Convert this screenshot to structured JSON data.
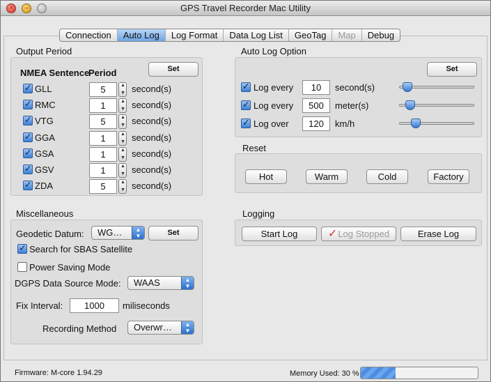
{
  "window": {
    "title": "GPS Travel Recorder Mac Utility"
  },
  "tabs": [
    {
      "label": "Connection",
      "state": "normal"
    },
    {
      "label": "Auto Log",
      "state": "active"
    },
    {
      "label": "Log Format",
      "state": "normal"
    },
    {
      "label": "Data Log List",
      "state": "normal"
    },
    {
      "label": "GeoTag",
      "state": "normal"
    },
    {
      "label": "Map",
      "state": "disabled"
    },
    {
      "label": "Debug",
      "state": "normal"
    }
  ],
  "output_period": {
    "title": "Output Period",
    "set_label": "Set",
    "col_sentence": "NMEA Sentence",
    "col_period": "Period",
    "unit": "second(s)",
    "rows": [
      {
        "name": "GLL",
        "checked": true,
        "value": "5"
      },
      {
        "name": "RMC",
        "checked": true,
        "value": "1"
      },
      {
        "name": "VTG",
        "checked": true,
        "value": "5"
      },
      {
        "name": "GGA",
        "checked": true,
        "value": "1"
      },
      {
        "name": "GSA",
        "checked": true,
        "value": "1"
      },
      {
        "name": "GSV",
        "checked": true,
        "value": "1"
      },
      {
        "name": "ZDA",
        "checked": true,
        "value": "5"
      }
    ]
  },
  "auto_log": {
    "title": "Auto Log Option",
    "set_label": "Set",
    "rows": [
      {
        "label": "Log every",
        "value": "10",
        "unit": "second(s)",
        "checked": true,
        "slider": 0.05
      },
      {
        "label": "Log every",
        "value": "500",
        "unit": "meter(s)",
        "checked": true,
        "slider": 0.1
      },
      {
        "label": "Log over",
        "value": "120",
        "unit": "km/h",
        "checked": true,
        "slider": 0.18
      }
    ]
  },
  "reset": {
    "title": "Reset",
    "hot": "Hot",
    "warm": "Warm",
    "cold": "Cold",
    "factory": "Factory"
  },
  "misc": {
    "title": "Miscellaneous",
    "datum_label": "Geodetic Datum:",
    "datum_value": "WG…",
    "set_label": "Set",
    "sbas_label": "Search for SBAS Satellite",
    "sbas_checked": true,
    "power_label": "Power Saving Mode",
    "power_checked": false,
    "dgps_label": "DGPS Data Source Mode:",
    "dgps_value": "WAAS",
    "fix_label": "Fix Interval:",
    "fix_value": "1000",
    "fix_unit": "miliseconds",
    "rec_label": "Recording Method",
    "rec_value": "Overwr…"
  },
  "logging": {
    "title": "Logging",
    "start": "Start Log",
    "stopped": "Log Stopped",
    "erase": "Erase Log"
  },
  "status": {
    "firmware": "Firmware: M-core 1.94.29",
    "memory_label": "Memory Used: 30 %",
    "memory_fraction": 0.3
  }
}
